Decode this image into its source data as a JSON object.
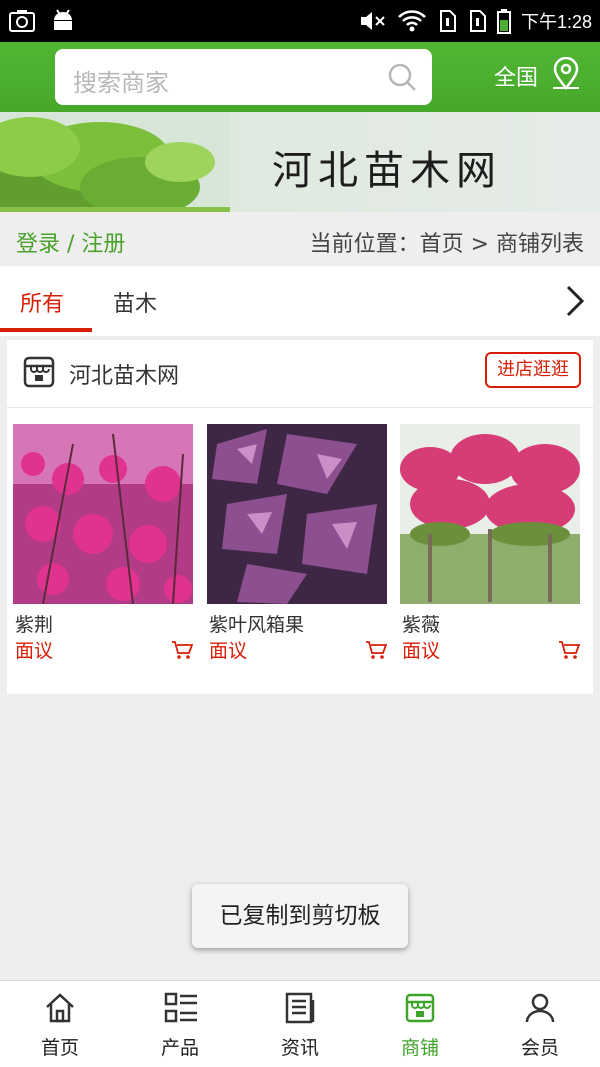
{
  "status_bar": {
    "time": "下午1:28"
  },
  "header": {
    "search_placeholder": "搜索商家",
    "region_label": "全国"
  },
  "banner": {
    "title": "河北苗木网"
  },
  "breadcrumb_row": {
    "login_label": "登录 / 注册",
    "location_text": "当前位置：首页 > 商铺列表"
  },
  "tabs": [
    {
      "label": "所有",
      "active": true
    },
    {
      "label": "苗木",
      "active": false
    }
  ],
  "shop": {
    "name": "河北苗木网",
    "enter_label": "进店逛逛",
    "products": [
      {
        "name": "紫荆",
        "price": "面议"
      },
      {
        "name": "紫叶风箱果",
        "price": "面议"
      },
      {
        "name": "紫薇",
        "price": "面议"
      }
    ]
  },
  "toast": "已复制到剪切板",
  "bottom_nav": [
    {
      "label": "首页",
      "icon": "home-icon",
      "active": false
    },
    {
      "label": "产品",
      "icon": "list-icon",
      "active": false
    },
    {
      "label": "资讯",
      "icon": "news-icon",
      "active": false
    },
    {
      "label": "商铺",
      "icon": "shop-icon",
      "active": true
    },
    {
      "label": "会员",
      "icon": "user-icon",
      "active": false
    }
  ],
  "colors": {
    "brand_green": "#4caf31",
    "accent_red": "#d81e06"
  }
}
